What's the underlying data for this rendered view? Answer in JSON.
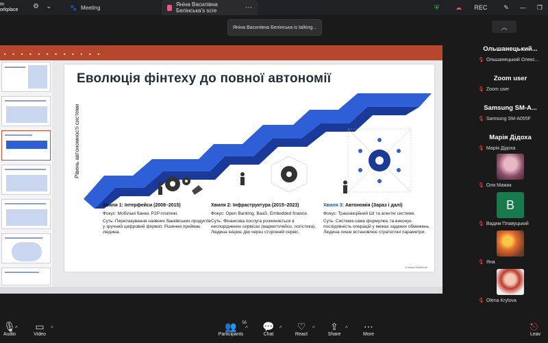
{
  "titlebar": {
    "brand_line1": "m",
    "brand_line2": "orkplace",
    "tab_meeting": "Meeting",
    "tab_share": "Яніна Василівна Белінська's scre",
    "rec_label": "REC"
  },
  "toast": {
    "text": "Яніна Василівна Белінська is talking..."
  },
  "slide": {
    "title": "Еволюція фінтеху до повної автономії",
    "y_axis_label": "Рівень автономності системи",
    "waves": [
      {
        "title": "Хвиля 1: Інтерфейси (2008–2015)",
        "focus": "Фокус: Мобільні банки, P2P-платежі.",
        "essence": "Суть: Перепакування наявних банківських продуктів у зручний цифровий формат. Рішення приймає людина."
      },
      {
        "title": "Хвиля 2: Інфраструктура (2015–2023)",
        "focus": "Фокус: Open Banking, BaaS, Embedded finance.",
        "essence": "Суть: Фінансова послуга розчиняється в неспоріднених сервісах (маркетплейси, логістика). Людина ініціює дію через сторонній сервіс."
      },
      {
        "title_label": "Хвиля 3:",
        "title_rest": "Автономія (Зараз і далі)",
        "focus": "Фокус: Транзакційний ШІ та агентні системи.",
        "essence": "Суть: Система сама формулює та виконує послідовність операцій у межах заданих обмежень. Людина лише встановлює стратегічні параметри."
      }
    ],
    "source": "Created Notebook"
  },
  "colors": {
    "stair_dark": "#1a3a99",
    "stair_light": "#2f5fd6",
    "title": "#1f2d3d",
    "accent_blue": "#1f4fb0"
  },
  "participants": [
    {
      "name": "Ольшанецький...",
      "sub": "Ольшанецький Олекс..."
    },
    {
      "name": "Zoom user",
      "sub": "Zoom user"
    },
    {
      "name": "Samsung  SM-A...",
      "sub": "Samsung SM-A055F"
    },
    {
      "name": "Марія Дідоха",
      "sub": "Марія Дідоха"
    },
    {
      "sub": "Оля Мажак"
    },
    {
      "letter": "B",
      "sub": "Вадим Плавуцький"
    },
    {
      "sub": "Яна"
    },
    {
      "sub": "Olena Krylova"
    }
  ],
  "toolbar": {
    "audio": "Audio",
    "video": "Video",
    "participants": "Participants",
    "participants_count": "56",
    "chat": "Chat",
    "react": "React",
    "share": "Share",
    "more": "More",
    "leave": "Leav"
  }
}
